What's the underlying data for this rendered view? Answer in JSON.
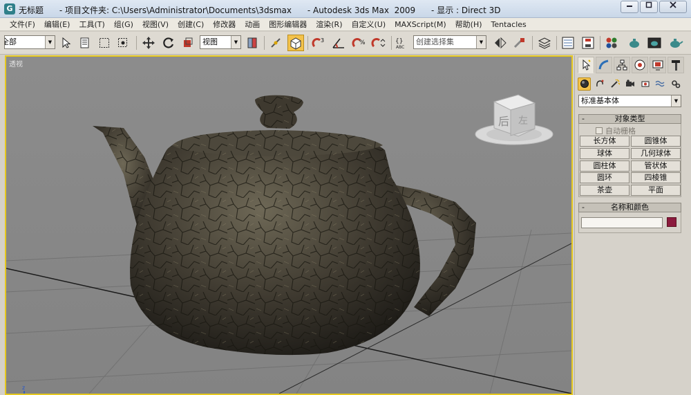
{
  "window": {
    "icon_glyph": "G",
    "title": "无标题      - 项目文件夹: C:\\Users\\Administrator\\Documents\\3dsmax      - Autodesk 3ds Max  2009      - 显示 : Direct 3D",
    "controls": [
      "minimize-icon",
      "restore-icon",
      "close-icon"
    ]
  },
  "menu": [
    "文件(F)",
    "编辑(E)",
    "工具(T)",
    "组(G)",
    "视图(V)",
    "创建(C)",
    "修改器",
    "动画",
    "图形编辑器",
    "渲染(R)",
    "自定义(U)",
    "MAXScript(M)",
    "帮助(H)",
    "Tentacles"
  ],
  "toolbar": {
    "selection_filter": "全部",
    "reference_coord": "视图",
    "named_selection_placeholder": "创建选择集",
    "active_tool": "select-and-manipulate"
  },
  "viewport": {
    "label": "透视",
    "viewcube": {
      "front_text": "后",
      "side_text": "左"
    },
    "axis_label": "z",
    "active_border_color": "#e6c81e"
  },
  "command_panel": {
    "category": "标准基本体",
    "object_type": {
      "title": "对象类型",
      "autogrid": "自动栅格",
      "buttons": [
        "长方体",
        "圆锥体",
        "球体",
        "几何球体",
        "圆柱体",
        "管状体",
        "圆环",
        "四棱锥",
        "茶壶",
        "平面"
      ]
    },
    "name_color": {
      "title": "名称和颜色",
      "name_value": "",
      "color": "#8b1a3d"
    }
  }
}
